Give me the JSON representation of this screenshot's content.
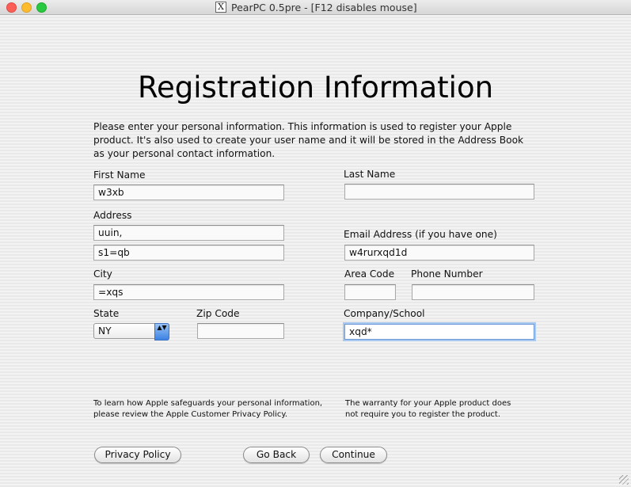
{
  "window": {
    "title": "PearPC 0.5pre - [F12 disables mouse]",
    "x11_glyph": "X"
  },
  "page": {
    "heading": "Registration Information",
    "intro": "Please enter your personal information. This information is used to register your Apple product. It's also used to create your user name and it will be stored in the Address Book as your personal contact information."
  },
  "form": {
    "first_name": {
      "label": "First Name",
      "value": "w3xb"
    },
    "last_name": {
      "label": "Last Name",
      "value": ""
    },
    "address": {
      "label": "Address",
      "line1": "uuin,",
      "line2": "s1=qb"
    },
    "email": {
      "label": "Email Address (if you have one)",
      "value": "w4rurxqd1d"
    },
    "city": {
      "label": "City",
      "value": "=xqs"
    },
    "area_code": {
      "label": "Area Code",
      "value": ""
    },
    "phone": {
      "label": "Phone Number",
      "value": ""
    },
    "state": {
      "label": "State",
      "value": "NY",
      "arrow": "▲▼"
    },
    "zip": {
      "label": "Zip Code",
      "value": ""
    },
    "company": {
      "label": "Company/School",
      "value": "xqd*"
    }
  },
  "notes": {
    "privacy": "To learn how Apple safeguards your personal information, please review the Apple Customer Privacy Policy.",
    "warranty": "The warranty for your Apple product does not require you to register the product."
  },
  "buttons": {
    "privacy_policy": "Privacy Policy",
    "go_back": "Go Back",
    "continue": "Continue"
  },
  "colors": {
    "focus_ring": "#a9c8f0",
    "close": "#fc5f57",
    "minimize": "#fdbc2e",
    "zoom": "#29c841"
  }
}
